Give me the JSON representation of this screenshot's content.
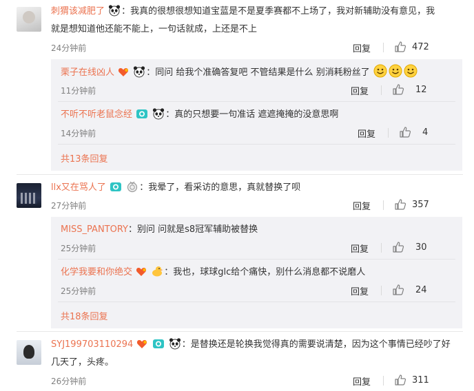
{
  "comments": [
    {
      "username": "刺猬该减肥了",
      "text_line1": "：我真的很想很想知道宝蓝是不是夏季赛都不上场了，我对新辅助没有意见，我",
      "text_line2": "就是想知道他还能不能上，一句话就成，上还是不上",
      "badges": [
        "panda-icon"
      ],
      "time": "24分钟前",
      "reply_label": "回复",
      "likes": "472",
      "replies": [
        {
          "username": "栗子在线凶人",
          "badges": [
            "heart-icon",
            "panda-icon"
          ],
          "text": "：同问 给我个准确答复吧 不管结果是什么 别消耗粉丝了",
          "emojis": [
            "smile-emoji",
            "smile-emoji",
            "smile-emoji"
          ],
          "time": "11分钟前",
          "reply_label": "回复",
          "likes": "12"
        },
        {
          "username": "不听不听老鼠念经",
          "badges": [
            "camera-icon",
            "panda-icon"
          ],
          "text": "：真的只想要一句准话 遮遮掩掩的没意思啊",
          "time": "14分钟前",
          "reply_label": "回复",
          "likes": "4"
        }
      ],
      "more_replies": "共13条回复"
    },
    {
      "username": "llx又在骂人了",
      "badges": [
        "camera-icon",
        "medal-icon"
      ],
      "text": "：我晕了，看采访的意思，真就替换了呗",
      "time": "27分钟前",
      "reply_label": "回复",
      "likes": "357",
      "replies": [
        {
          "username": "MISS_PANTORY",
          "badges": [],
          "text": "：别问  问就是s8冠军辅助被替换",
          "time": "25分钟前",
          "reply_label": "回复",
          "likes": "30"
        },
        {
          "username": "化学我要和你绝交",
          "badges": [
            "heart-icon",
            "duck-icon"
          ],
          "text": "：我也，球球glc给个痛快，别什么消息都不说磨人",
          "time": "25分钟前",
          "reply_label": "回复",
          "likes": "24"
        }
      ],
      "more_replies": "共18条回复"
    },
    {
      "username": "SYJ199703110294",
      "badges": [
        "heart-icon",
        "camera-icon",
        "panda-icon"
      ],
      "text_line1": "：是替换还是轮换我觉得真的需要说清楚，因为这个事情已经吵了好",
      "text_line2": "几天了，头疼。",
      "time": "26分钟前",
      "reply_label": "回复",
      "likes": "311"
    }
  ],
  "colors": {
    "username": "#eb7350",
    "subbox_bg": "#f2f2f5",
    "meta": "#808080",
    "text": "#333333"
  }
}
